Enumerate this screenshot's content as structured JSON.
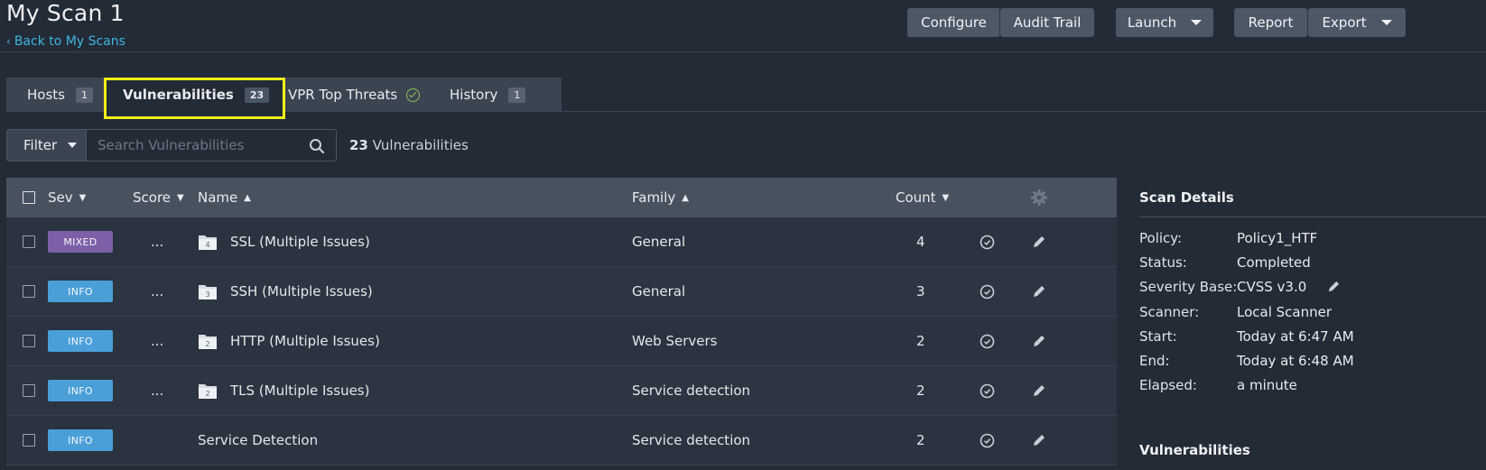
{
  "header": {
    "title": "My Scan 1",
    "back_link": "Back to My Scans",
    "buttons": {
      "configure": "Configure",
      "audit_trail": "Audit Trail",
      "launch": "Launch",
      "report": "Report",
      "export": "Export"
    }
  },
  "tabs": [
    {
      "label": "Hosts",
      "badge": "1"
    },
    {
      "label": "Vulnerabilities",
      "badge": "23"
    },
    {
      "label": "VPR Top Threats",
      "badge": ""
    },
    {
      "label": "History",
      "badge": "1"
    }
  ],
  "filter": {
    "label": "Filter",
    "search_placeholder": "Search Vulnerabilities",
    "count_number": "23",
    "count_label": "Vulnerabilities"
  },
  "table": {
    "headers": {
      "sev": "Sev",
      "score": "Score",
      "name": "Name",
      "family": "Family",
      "count": "Count"
    },
    "rows": [
      {
        "sev": "MIXED",
        "sev_color": "#7c5fa6",
        "score": "...",
        "folder_count": "4",
        "name": "SSL (Multiple Issues)",
        "family": "General",
        "count": "4"
      },
      {
        "sev": "INFO",
        "sev_color": "#4a9fd8",
        "score": "...",
        "folder_count": "3",
        "name": "SSH (Multiple Issues)",
        "family": "General",
        "count": "3"
      },
      {
        "sev": "INFO",
        "sev_color": "#4a9fd8",
        "score": "...",
        "folder_count": "2",
        "name": "HTTP (Multiple Issues)",
        "family": "Web Servers",
        "count": "2"
      },
      {
        "sev": "INFO",
        "sev_color": "#4a9fd8",
        "score": "...",
        "folder_count": "2",
        "name": "TLS (Multiple Issues)",
        "family": "Service detection",
        "count": "2"
      },
      {
        "sev": "INFO",
        "sev_color": "#4a9fd8",
        "score": "",
        "folder_count": "",
        "name": "Service Detection",
        "family": "Service detection",
        "count": "2"
      }
    ]
  },
  "scan_details": {
    "title": "Scan Details",
    "items": [
      {
        "label": "Policy:",
        "value": "Policy1_HTF"
      },
      {
        "label": "Status:",
        "value": "Completed"
      },
      {
        "label": "Severity Base:",
        "value": "CVSS v3.0"
      },
      {
        "label": "Scanner:",
        "value": "Local Scanner"
      },
      {
        "label": "Start:",
        "value": "Today at 6:47 AM"
      },
      {
        "label": "End:",
        "value": "Today at 6:48 AM"
      },
      {
        "label": "Elapsed:",
        "value": "a minute"
      }
    ],
    "vulnerabilities_title": "Vulnerabilities"
  },
  "colors": {
    "background": "#232b36",
    "accent_link": "#3fb5e0",
    "highlight": "#f2ef17",
    "sev_mixed": "#7c5fa6",
    "sev_info": "#4a9fd8"
  }
}
